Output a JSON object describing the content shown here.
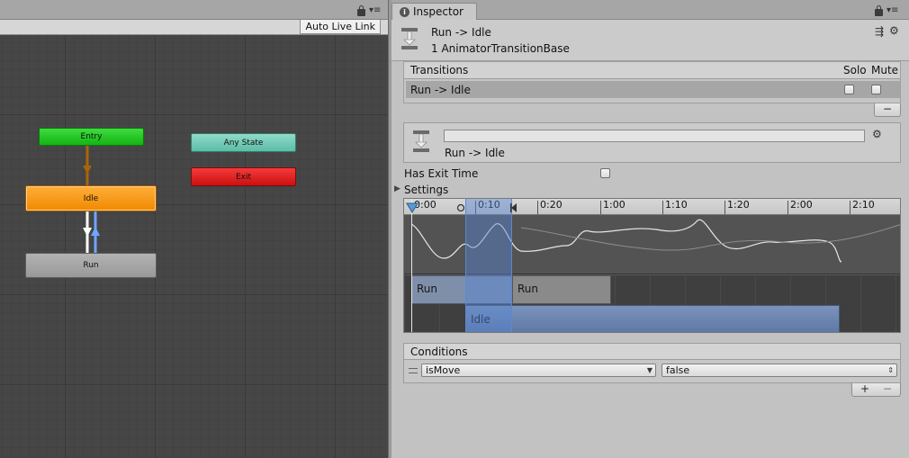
{
  "animator": {
    "live_link_label": "Auto Live Link",
    "states": {
      "entry": "Entry",
      "idle": "Idle",
      "run": "Run",
      "any_state": "Any State",
      "exit": "Exit"
    },
    "colors": {
      "entry": "#22c322",
      "idle": "#f39a12",
      "run": "#a6a6a6",
      "any_state": "#72ccb8",
      "exit": "#e02020",
      "transition_selected": "#6fa6ff",
      "entry_transition": "#b26a00"
    }
  },
  "inspector": {
    "tab_label": "Inspector",
    "header": {
      "title": "Run -> Idle",
      "subtitle": "1 AnimatorTransitionBase"
    },
    "transitions": {
      "header": "Transitions",
      "solo_label": "Solo",
      "mute_label": "Mute",
      "rows": [
        {
          "name": "Run -> Idle",
          "solo": false,
          "mute": false
        }
      ],
      "remove_label": "−"
    },
    "transition": {
      "name_value": "",
      "title": "Run -> Idle"
    },
    "has_exit_time": {
      "label": "Has Exit Time",
      "checked": false
    },
    "settings_label": "Settings",
    "timeline": {
      "ticks": [
        "0:00",
        "0:10",
        "0:20",
        "1:00",
        "1:10",
        "1:20",
        "2:00",
        "2:10"
      ],
      "clips": {
        "run1": "Run",
        "run2": "Run",
        "idle": "Idle"
      }
    },
    "conditions": {
      "header": "Conditions",
      "rows": [
        {
          "parameter": "isMove",
          "value": "false"
        }
      ],
      "add_label": "+",
      "remove_label": "−"
    }
  }
}
